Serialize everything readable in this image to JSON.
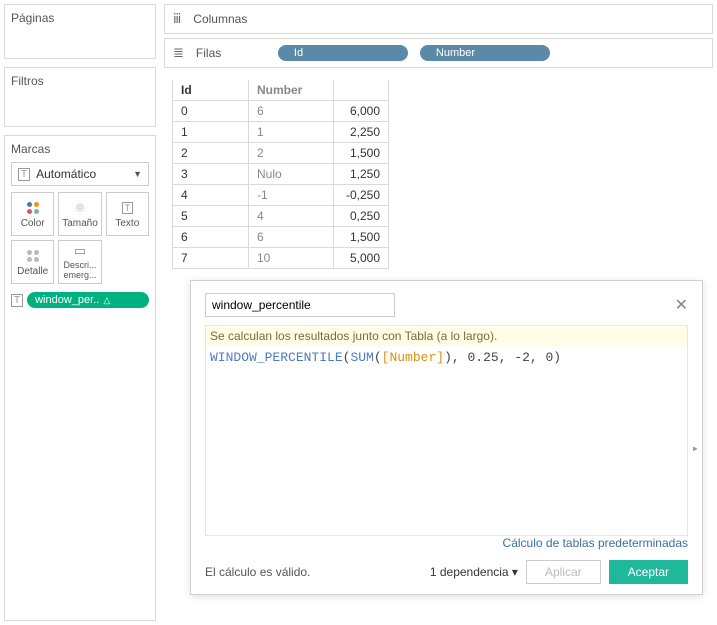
{
  "left": {
    "pages_title": "Páginas",
    "filters_title": "Filtros",
    "marks_title": "Marcas",
    "mark_type": "Automático",
    "cells": {
      "color": "Color",
      "size": "Tamaño",
      "text": "Texto",
      "detail": "Detalle",
      "tooltip": "Descri... emerg..."
    },
    "pill_label": "window_per.."
  },
  "shelves": {
    "columns_label": "Columnas",
    "rows_label": "Filas",
    "pill_id": "Id",
    "pill_number": "Number"
  },
  "table": {
    "header_id": "Id",
    "header_number": "Number",
    "rows": [
      {
        "id": "0",
        "number": "6",
        "value": "6,000"
      },
      {
        "id": "1",
        "number": "1",
        "value": "2,250"
      },
      {
        "id": "2",
        "number": "2",
        "value": "1,500"
      },
      {
        "id": "3",
        "number": "Nulo",
        "value": "1,250"
      },
      {
        "id": "4",
        "number": "-1",
        "value": "-0,250"
      },
      {
        "id": "5",
        "number": "4",
        "value": "0,250"
      },
      {
        "id": "6",
        "number": "6",
        "value": "1,500"
      },
      {
        "id": "7",
        "number": "10",
        "value": "5,000"
      }
    ]
  },
  "calc": {
    "name": "window_percentile",
    "yellow_msg": "Se calculan los resultados junto con Tabla (a lo largo).",
    "fn": "WINDOW_PERCENTILE",
    "agg": "SUM",
    "field": "[Number]",
    "args": ", 0.25, -2, 0)",
    "default_link": "Cálculo de tablas predeterminadas",
    "valid": "El cálculo es válido.",
    "dependency": "1 dependencia",
    "apply": "Aplicar",
    "ok": "Aceptar"
  }
}
